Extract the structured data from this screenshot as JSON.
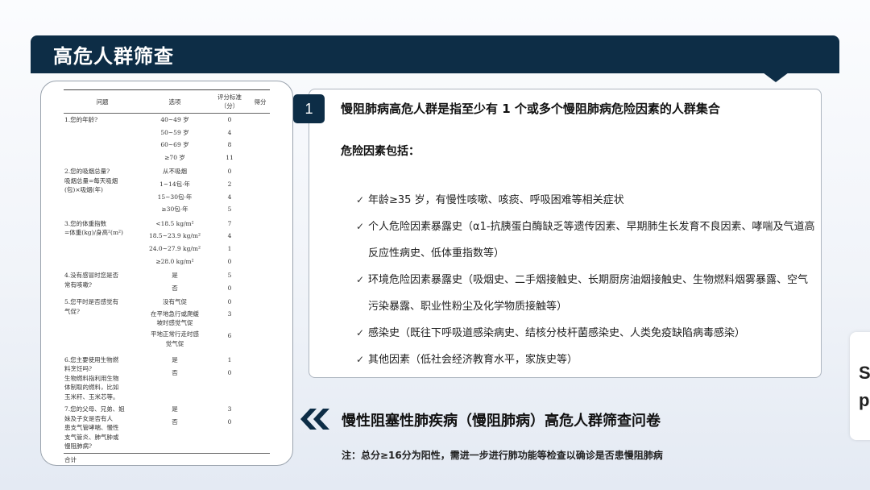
{
  "slide": {
    "title": "高危人群筛查"
  },
  "questionnaire": {
    "headers": [
      "问题",
      "选项",
      "评分标准\n（分）",
      "得分"
    ],
    "groups": [
      {
        "q": "1.您的年龄?",
        "rows": [
          {
            "o": "40~49 岁",
            "s": "0"
          },
          {
            "o": "50~59 岁",
            "s": "4"
          },
          {
            "o": "60~69 岁",
            "s": "8"
          },
          {
            "o": "≥70 岁",
            "s": "11"
          }
        ]
      },
      {
        "q": "2.您的吸烟总量?\n  吸烟总量=每天吸烟\n  (包)×吸烟(年)",
        "rows": [
          {
            "o": "从不吸烟",
            "s": "0"
          },
          {
            "o": "1~14包·年",
            "s": "2"
          },
          {
            "o": "15~30包·年",
            "s": "4"
          },
          {
            "o": "≥30包·年",
            "s": "5"
          }
        ]
      },
      {
        "q": "3.您的体重指数\n  =体重(kg)/身高²(m²)",
        "rows": [
          {
            "o": "<18.5 kg/m²",
            "s": "7"
          },
          {
            "o": "18.5~23.9 kg/m²",
            "s": "4"
          },
          {
            "o": "24.0~27.9 kg/m²",
            "s": "1"
          },
          {
            "o": "≥28.0 kg/m²",
            "s": "0"
          }
        ]
      },
      {
        "q": "4.没有感冒时您是否\n  常有咳嗽?",
        "rows": [
          {
            "o": "是",
            "s": "5"
          },
          {
            "o": "否",
            "s": "0"
          }
        ]
      },
      {
        "q": "5.您平时是否感觉有\n  气促?",
        "rows": [
          {
            "o": "没有气促",
            "s": "0"
          },
          {
            "o": "在平地急行或爬缓\n坡时感觉气促",
            "s": "3"
          },
          {
            "o": "平地正常行走时感\n觉气促",
            "s": "6"
          }
        ]
      },
      {
        "q": "6.您主要使用生物燃\n  料烹饪吗?\n  生物燃料指利用生物\n  体制取的燃料，比如\n  玉米秆、玉米芯等。",
        "rows": [
          {
            "o": "是",
            "s": "1"
          },
          {
            "o": "否",
            "s": "0"
          }
        ]
      },
      {
        "q": "7.您的父母、兄弟、姐\n  妹及子女是否有人\n  患支气管哮喘、慢性\n  支气管炎、肺气肿或\n  慢阻肺病?",
        "rows": [
          {
            "o": "是",
            "s": "3"
          },
          {
            "o": "否",
            "s": "0"
          }
        ]
      }
    ],
    "total_label": "合计"
  },
  "info": {
    "number": "1",
    "headline": "慢阻肺病高危人群是指至少有 1 个或多个慢阻肺病危险因素的人群集合",
    "subhead": "危险因素包括：",
    "check_glyph": "✓",
    "factors": [
      "年龄≥35 岁，有慢性咳嗽、咳痰、呼吸困难等相关症状",
      "个人危险因素暴露史（α1-抗胰蛋白酶缺乏等遗传因素、早期肺生长发育不良因素、哮喘及气道高反应性病史、低体重指数等）",
      "环境危险因素暴露史（吸烟史、二手烟接触史、长期厨房油烟接触史、生物燃料烟雾暴露、空气污染暴露、职业性粉尘及化学物质接触等）",
      "感染史（既往下呼吸道感染病史、结核分枝杆菌感染史、人类免疫缺陷病毒感染）",
      "其他因素（低社会经济教育水平，家族史等）"
    ]
  },
  "bottom": {
    "title": "慢性阻塞性肺疾病（慢阻肺病）高危人群筛查问卷",
    "note": "注：总分≥16分为阳性，需进一步进行肺功能等检查以确诊是否患慢阻肺病",
    "icon": "double-chevron-left-icon"
  },
  "side_panel": {
    "line1": "S",
    "line2": "p"
  },
  "colors": {
    "navy": "#0d2d46",
    "background": "#f1f4f9"
  }
}
